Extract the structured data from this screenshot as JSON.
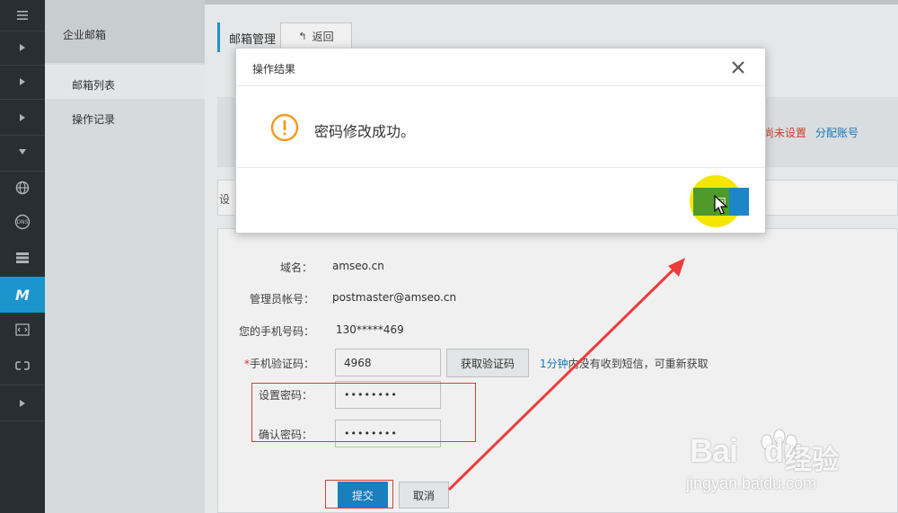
{
  "rail": {
    "items": [
      {
        "icon": "menu-icon"
      },
      {
        "icon": "chevron-right-icon"
      },
      {
        "icon": "chevron-right-icon"
      },
      {
        "icon": "chevron-right-icon"
      },
      {
        "icon": "caret-down-icon"
      },
      {
        "icon": "globe-icon"
      },
      {
        "icon": "dns-icon",
        "label": "DNS"
      },
      {
        "icon": "server-icon"
      },
      {
        "icon": "mail-m-icon",
        "label": "M"
      },
      {
        "icon": "bracket-icon"
      },
      {
        "icon": "link-icon"
      },
      {
        "icon": "chevron-right-icon"
      }
    ],
    "active_color": "#1d9fd8"
  },
  "sidebar": {
    "title": "企业邮箱",
    "items": [
      {
        "label": "邮箱列表"
      },
      {
        "label": "操作记录"
      }
    ]
  },
  "header": {
    "title": "邮箱管理",
    "back_label": "返回"
  },
  "band": {
    "status": "尚未设置",
    "link": "分配账号"
  },
  "tabs_fragment": "设",
  "form": {
    "domain_label": "域名：",
    "domain_value": "amseo.cn",
    "admin_label": "管理员帐号：",
    "admin_value": "postmaster@amseo.cn",
    "phone_label": "您的手机号码：",
    "phone_value": "130*****469",
    "code_required": "*",
    "code_label": "手机验证码：",
    "code_value": "4968",
    "get_code_label": "获取验证码",
    "hint_time": "1分钟",
    "hint_rest": "内没有收到短信，可重新获取",
    "password_label": "设置密码：",
    "password_value": "••••••••",
    "confirm_label": "确认密码：",
    "confirm_value": "••••••••",
    "submit_label": "提交",
    "cancel_label": "取消"
  },
  "modal": {
    "title": "操作结果",
    "message": "密码修改成功。",
    "ok_label": "返回",
    "ok_label_visible": "回"
  },
  "watermark": {
    "brand": "Bai",
    "brand2": "du",
    "cn": "经验",
    "url": "jingyan.baidu.com"
  },
  "colors": {
    "accent": "#1d9fd8",
    "button": "#1d86c9",
    "annotation": "#e0453a",
    "highlight": "#f3e600",
    "warning": "#f39a1e"
  }
}
